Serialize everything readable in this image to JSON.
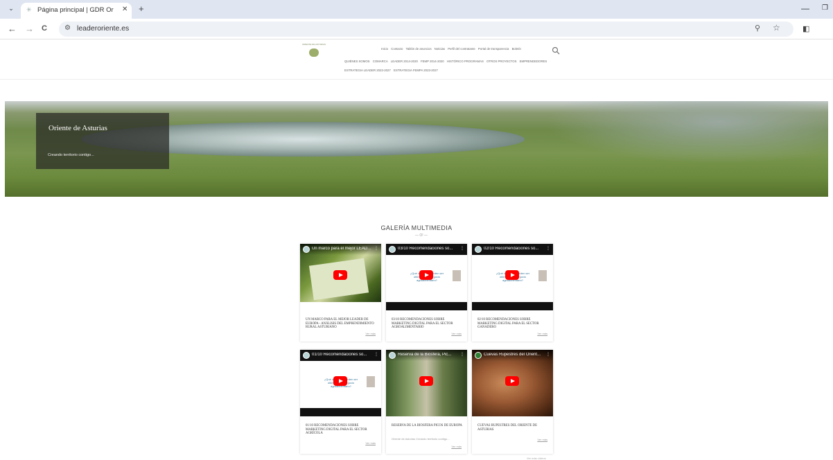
{
  "browser": {
    "tab_title": "Página principal | GDR Oriente",
    "url": "leaderoriente.es",
    "tab_list_glyph": "⌄",
    "tab_close_glyph": "✕",
    "new_tab_glyph": "+",
    "minimize_glyph": "—",
    "restore_glyph": "❐",
    "back_glyph": "←",
    "forward_glyph": "→",
    "reload_glyph": "C",
    "site_info_glyph": "⚙",
    "zoom_glyph": "⚲",
    "star_glyph": "☆",
    "side_panel_glyph": "◧"
  },
  "header": {
    "logo_text": "ORIENTE DE ASTURIAS",
    "nav_row1": [
      "Inicio",
      "Contacto",
      "Tablón de anuncios",
      "Noticias",
      "Perfil del contratante",
      "Portal de transparencia",
      "Boletín"
    ],
    "nav_row2": [
      "QUIÉNES SOMOS",
      "COMARCA",
      "LEADER 2014-2020",
      "FEMP 2014-2020",
      "HISTÓRICO PROGRAMAS",
      "OTROS PROYECTOS",
      "EMPRENDEDORES"
    ],
    "nav_row3": [
      "ESTRATEGIA LEADER 2023-2027",
      "ESTRATEGIA FEMPA 2023-2027"
    ]
  },
  "hero": {
    "title": "Oriente de Asturias",
    "subtitle": "Creando territorio contigo..."
  },
  "gallery": {
    "title": "GALERÍA MULTIMEDIA",
    "divider": "— O! —",
    "read_more": "Ver más",
    "more_link": "Ver más vídeos",
    "cards": [
      {
        "video_title": "Un marco para el mejor LEAD...",
        "title": "UN MARCO PARA EL MEJOR LEADER DE EUROPA - ANÁLISIS DEL EMPRENDIMIENTO RURAL ASTURIANO",
        "excerpt": ""
      },
      {
        "video_title": "03/10 Recomendaciones so...",
        "title": "03/10 RECOMENDACIONES SOBRE MARKETING DIGITAL PARA EL SECTOR AGROALIMENTARIO",
        "excerpt": ""
      },
      {
        "video_title": "02/10 Recomendaciones so...",
        "title": "02/10 RECOMENDACIONES SOBRE MARKETING DIGITAL PARA EL SECTOR GANADERO",
        "excerpt": ""
      },
      {
        "video_title": "01/10 Recomendaciones so...",
        "title": "01/10 RECOMENDACIONES SOBRE MARKETING DIGITAL PARA EL SECTOR AGRÍCOLA",
        "excerpt": ""
      },
      {
        "video_title": "Reserva de la Biosfera, Pic...",
        "title": "RESERVA DE LA BIOSFERA PICOS DE EUROPA",
        "excerpt": "Oriente de Asturias Creando territorio contigo..."
      },
      {
        "video_title": "Cuevas Rupestres del Orient...",
        "title": "CUEVAS RUPESTRES DEL ORIENTE DE ASTURIAS",
        "excerpt": ""
      }
    ],
    "slide_text": "¿Qué opciones pueden ser útiles para tu negocio agroalimentario?"
  }
}
